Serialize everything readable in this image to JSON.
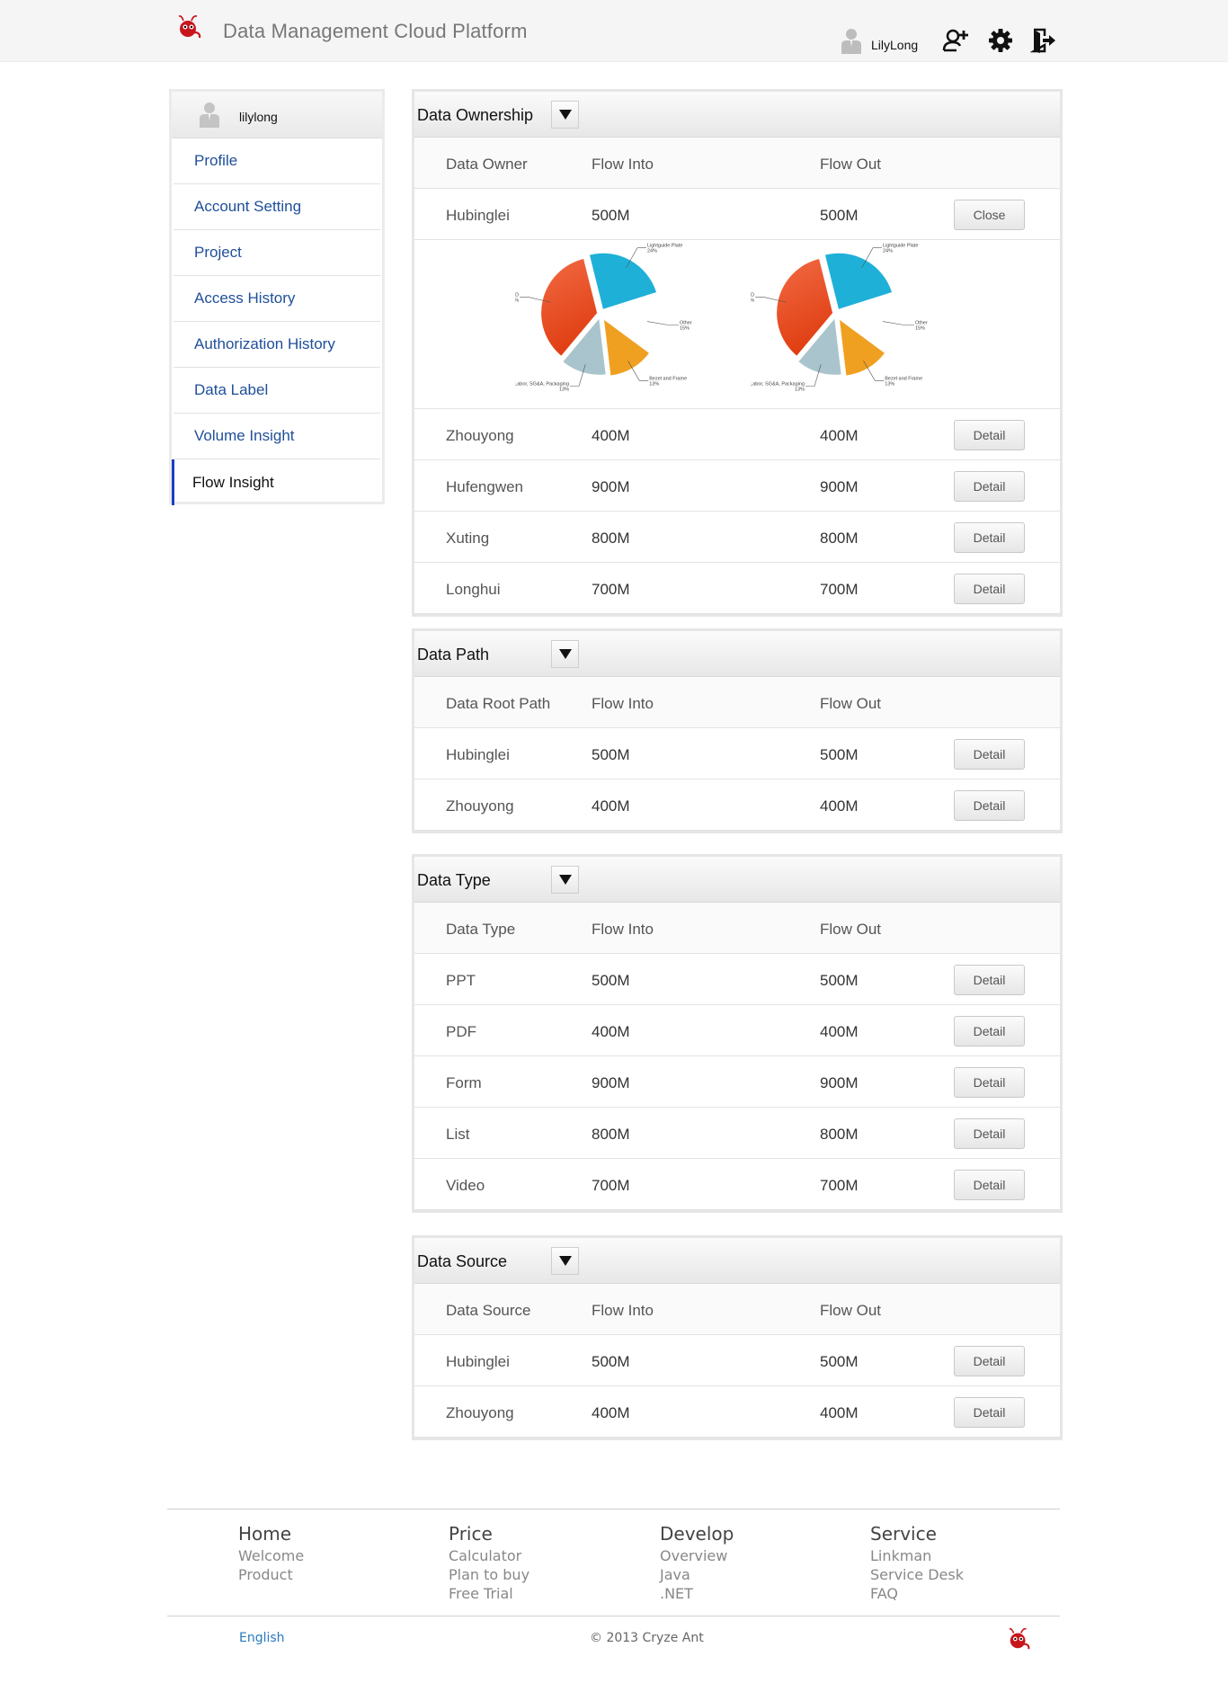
{
  "header": {
    "title": "Data Management Cloud Platform",
    "username": "LilyLong"
  },
  "sidebar": {
    "username": "lilylong",
    "items": [
      {
        "label": "Profile"
      },
      {
        "label": "Account Setting"
      },
      {
        "label": "Project"
      },
      {
        "label": "Access History"
      },
      {
        "label": "Authorization History"
      },
      {
        "label": "Data Label"
      },
      {
        "label": "Volume Insight"
      },
      {
        "label": "Flow Insight",
        "active": true
      }
    ]
  },
  "panels": {
    "ownership": {
      "title": "Data Ownership",
      "headers": [
        "Data Owner",
        "Flow Into",
        "Flow Out"
      ],
      "rows": [
        {
          "name": "Hubinglei",
          "into": "500M",
          "out": "500M",
          "button": "Close"
        },
        {
          "name": "Zhouyong",
          "into": "400M",
          "out": "400M",
          "button": "Detail"
        },
        {
          "name": "Hufengwen",
          "into": "900M",
          "out": "900M",
          "button": "Detail"
        },
        {
          "name": "Xuting",
          "into": "800M",
          "out": "800M",
          "button": "Detail"
        },
        {
          "name": "Longhui",
          "into": "700M",
          "out": "700M",
          "button": "Detail"
        }
      ]
    },
    "path": {
      "title": "Data Path",
      "headers": [
        "Data Root Path",
        "Flow Into",
        "Flow Out"
      ],
      "rows": [
        {
          "name": "Hubinglei",
          "into": "500M",
          "out": "500M",
          "button": "Detail"
        },
        {
          "name": "Zhouyong",
          "into": "400M",
          "out": "400M",
          "button": "Detail"
        }
      ]
    },
    "type": {
      "title": "Data Type",
      "headers": [
        "Data Type",
        "Flow Into",
        "Flow Out"
      ],
      "rows": [
        {
          "name": "PPT",
          "into": "500M",
          "out": "500M",
          "button": "Detail"
        },
        {
          "name": "PDF",
          "into": "400M",
          "out": "400M",
          "button": "Detail"
        },
        {
          "name": "Form",
          "into": "900M",
          "out": "900M",
          "button": "Detail"
        },
        {
          "name": "List",
          "into": "800M",
          "out": "800M",
          "button": "Detail"
        },
        {
          "name": "Video",
          "into": "700M",
          "out": "700M",
          "button": "Detail"
        }
      ]
    },
    "source": {
      "title": "Data Source",
      "headers": [
        "Data Source",
        "Flow Into",
        "Flow Out"
      ],
      "rows": [
        {
          "name": "Hubinglei",
          "into": "500M",
          "out": "500M",
          "button": "Detail"
        },
        {
          "name": "Zhouyong",
          "into": "400M",
          "out": "400M",
          "button": "Detail"
        }
      ]
    }
  },
  "chart_data": [
    {
      "type": "pie",
      "title": "",
      "slices": [
        {
          "label": "Lightguide Plate",
          "value": 24,
          "pct": "24%",
          "color": "#1fb0d8"
        },
        {
          "label": "Other",
          "value": 15,
          "pct": "15%",
          "color": "#ffffff"
        },
        {
          "label": "Bezel and Frame",
          "value": 13,
          "pct": "13%",
          "color": "#f0a020"
        },
        {
          "label": "Labor, SG&A, Packaging",
          "value": 13,
          "pct": "13%",
          "color": "#a9c4cc"
        },
        {
          "label": "LED",
          "value": 35,
          "pct": "35%",
          "color": "#e9542a"
        }
      ]
    },
    {
      "type": "pie",
      "title": "",
      "slices": [
        {
          "label": "Lightguide Plate",
          "value": 24,
          "pct": "24%",
          "color": "#1fb0d8"
        },
        {
          "label": "Other",
          "value": 15,
          "pct": "15%",
          "color": "#ffffff"
        },
        {
          "label": "Bezel and Frame",
          "value": 13,
          "pct": "13%",
          "color": "#f0a020"
        },
        {
          "label": "Labor, SG&A, Packaging",
          "value": 13,
          "pct": "13%",
          "color": "#a9c4cc"
        },
        {
          "label": "LED",
          "value": 35,
          "pct": "35%",
          "color": "#e9542a"
        }
      ]
    }
  ],
  "footer": {
    "columns": [
      {
        "heading": "Home",
        "links": [
          "Welcome",
          "Product"
        ]
      },
      {
        "heading": "Price",
        "links": [
          "Calculator",
          "Plan to buy",
          "Free Trial"
        ]
      },
      {
        "heading": "Develop",
        "links": [
          "Overview",
          "Java",
          ".NET"
        ]
      },
      {
        "heading": "Service",
        "links": [
          "Linkman",
          "Service Desk",
          "FAQ"
        ]
      }
    ],
    "language": "English",
    "copyright": "© 2013 Cryze Ant"
  },
  "icons": {
    "logo": "ant-logo-icon",
    "user": "user-icon",
    "add_user": "add-user-icon",
    "settings": "gear-icon",
    "logout": "logout-icon",
    "dropdown": "triangle-down-icon"
  },
  "colors": {
    "link_blue": "#1f4f99",
    "active_bar": "#1a3fc1",
    "footer_link": "#2a7ac0"
  }
}
